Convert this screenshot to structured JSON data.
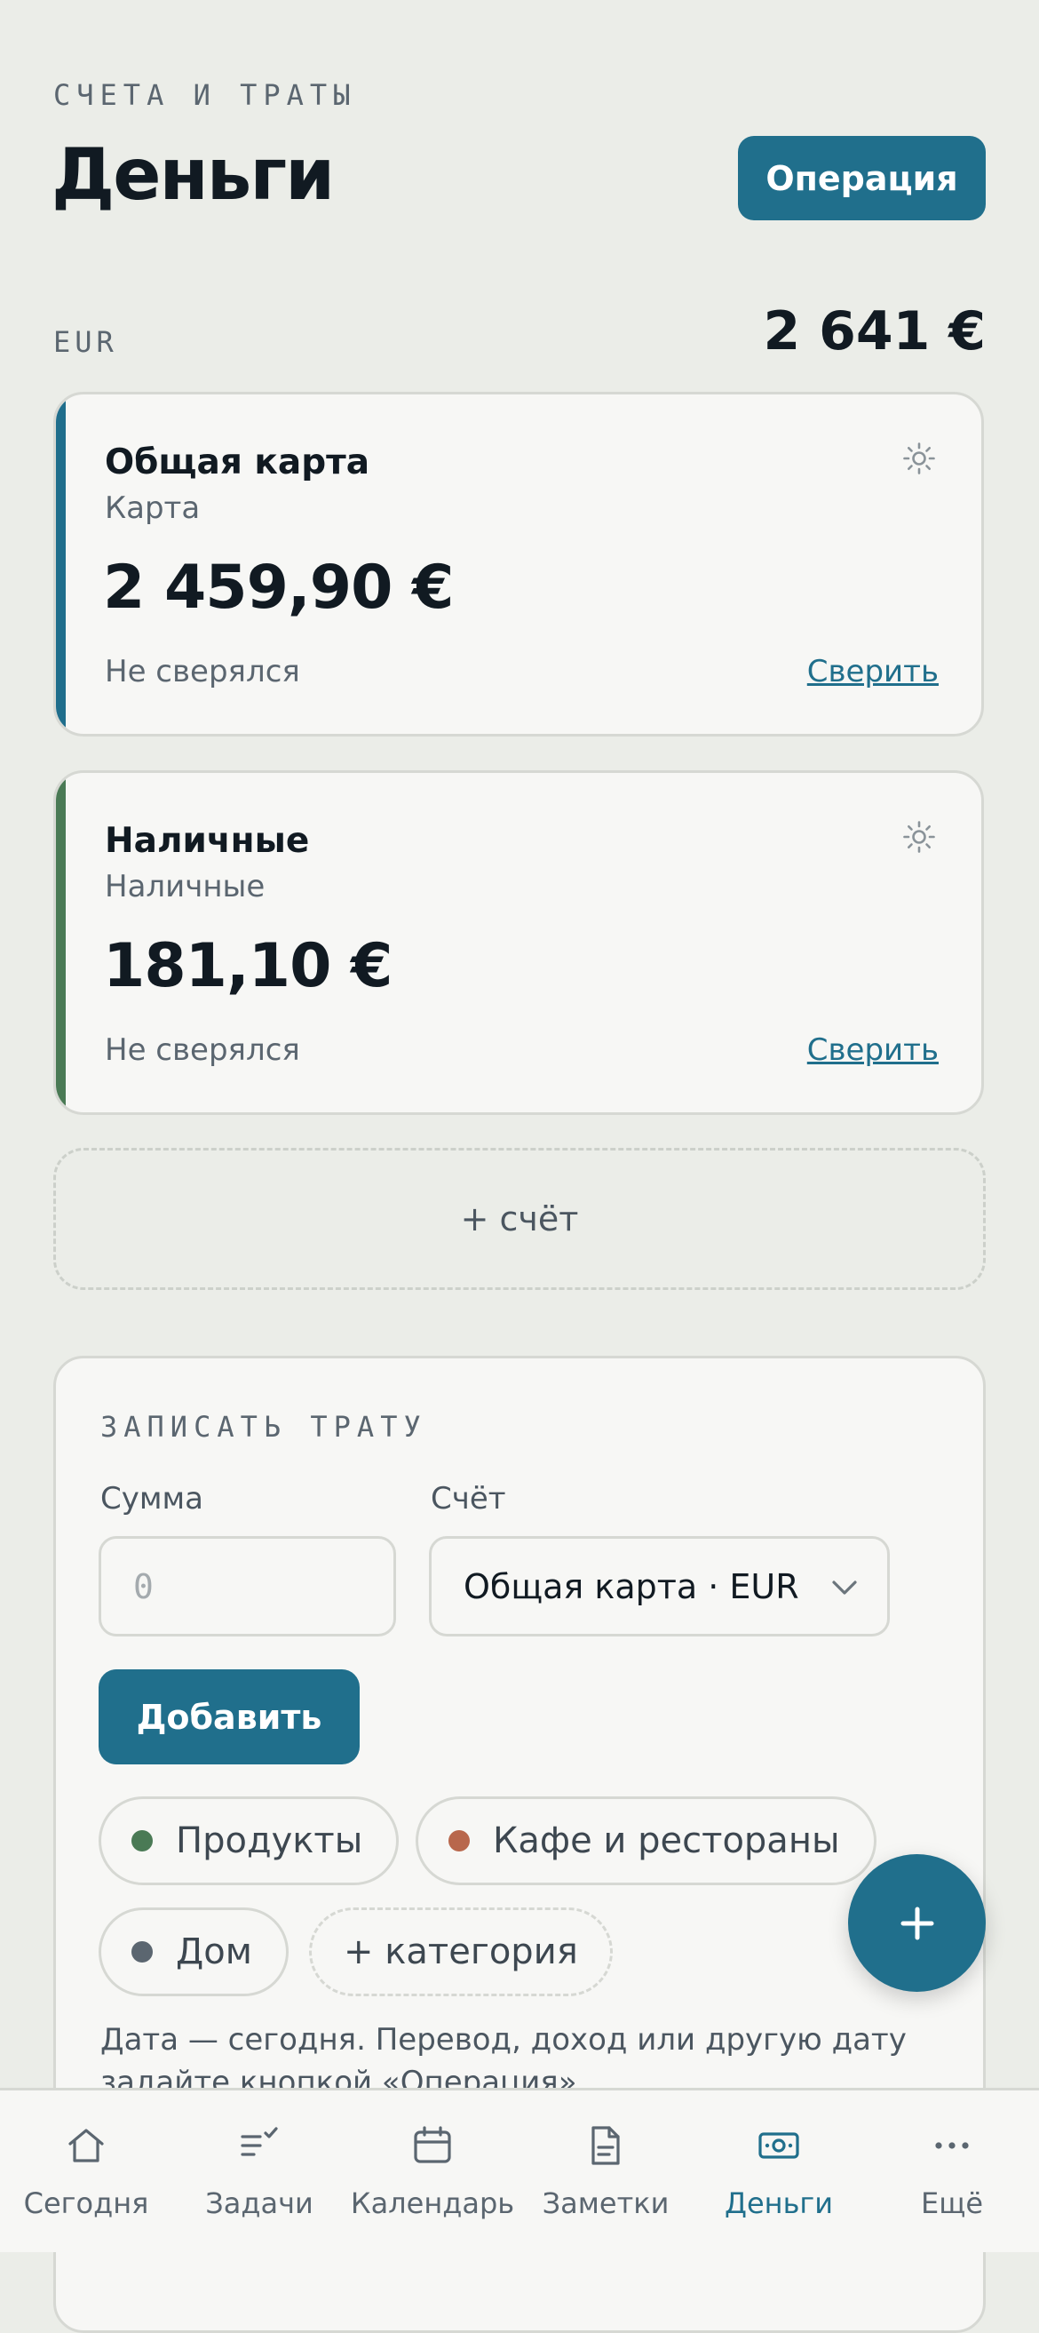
{
  "header": {
    "eyebrow": "СЧЕТА И ТРАТЫ",
    "title": "Деньги",
    "operation_button": "Операция"
  },
  "currency": {
    "code": "EUR",
    "total": "2 641 €"
  },
  "accounts": [
    {
      "name": "Общая карта",
      "type": "Карта",
      "balance": "2 459,90 €",
      "status": "Не сверялся",
      "reconcile_label": "Сверить",
      "accent_color": "#1f6e8c",
      "settings_icon": "gear-icon"
    },
    {
      "name": "Наличные",
      "type": "Наличные",
      "balance": "181,10 €",
      "status": "Не сверялся",
      "reconcile_label": "Сверить",
      "accent_color": "#4a7a55",
      "settings_icon": "gear-icon"
    }
  ],
  "add_account_label": "+ счёт",
  "expense_form": {
    "title": "ЗАПИСАТЬ ТРАТУ",
    "amount_label": "Сумма",
    "amount_placeholder": "0",
    "account_label": "Счёт",
    "account_value": "Общая карта · EUR",
    "add_button": "Добавить",
    "categories": [
      {
        "label": "Продукты",
        "color": "#4a7a55"
      },
      {
        "label": "Кафе и рестораны",
        "color": "#b8674c"
      },
      {
        "label": "Дом",
        "color": "#5b6670"
      }
    ],
    "add_category_label": "+ категория",
    "hint": "Дата — сегодня. Перевод, доход или другую дату задайте кнопкой «Операция»."
  },
  "fab": {
    "icon": "plus-icon"
  },
  "tabbar": {
    "items": [
      {
        "label": "Сегодня",
        "icon": "home-icon"
      },
      {
        "label": "Задачи",
        "icon": "tasks-icon"
      },
      {
        "label": "Календарь",
        "icon": "calendar-icon"
      },
      {
        "label": "Заметки",
        "icon": "note-icon"
      },
      {
        "label": "Деньги",
        "icon": "money-icon",
        "active": true
      },
      {
        "label": "Ещё",
        "icon": "more-icon"
      }
    ]
  },
  "colors": {
    "accent": "#206f8c",
    "background": "#ebede8",
    "card": "#f7f7f5"
  }
}
